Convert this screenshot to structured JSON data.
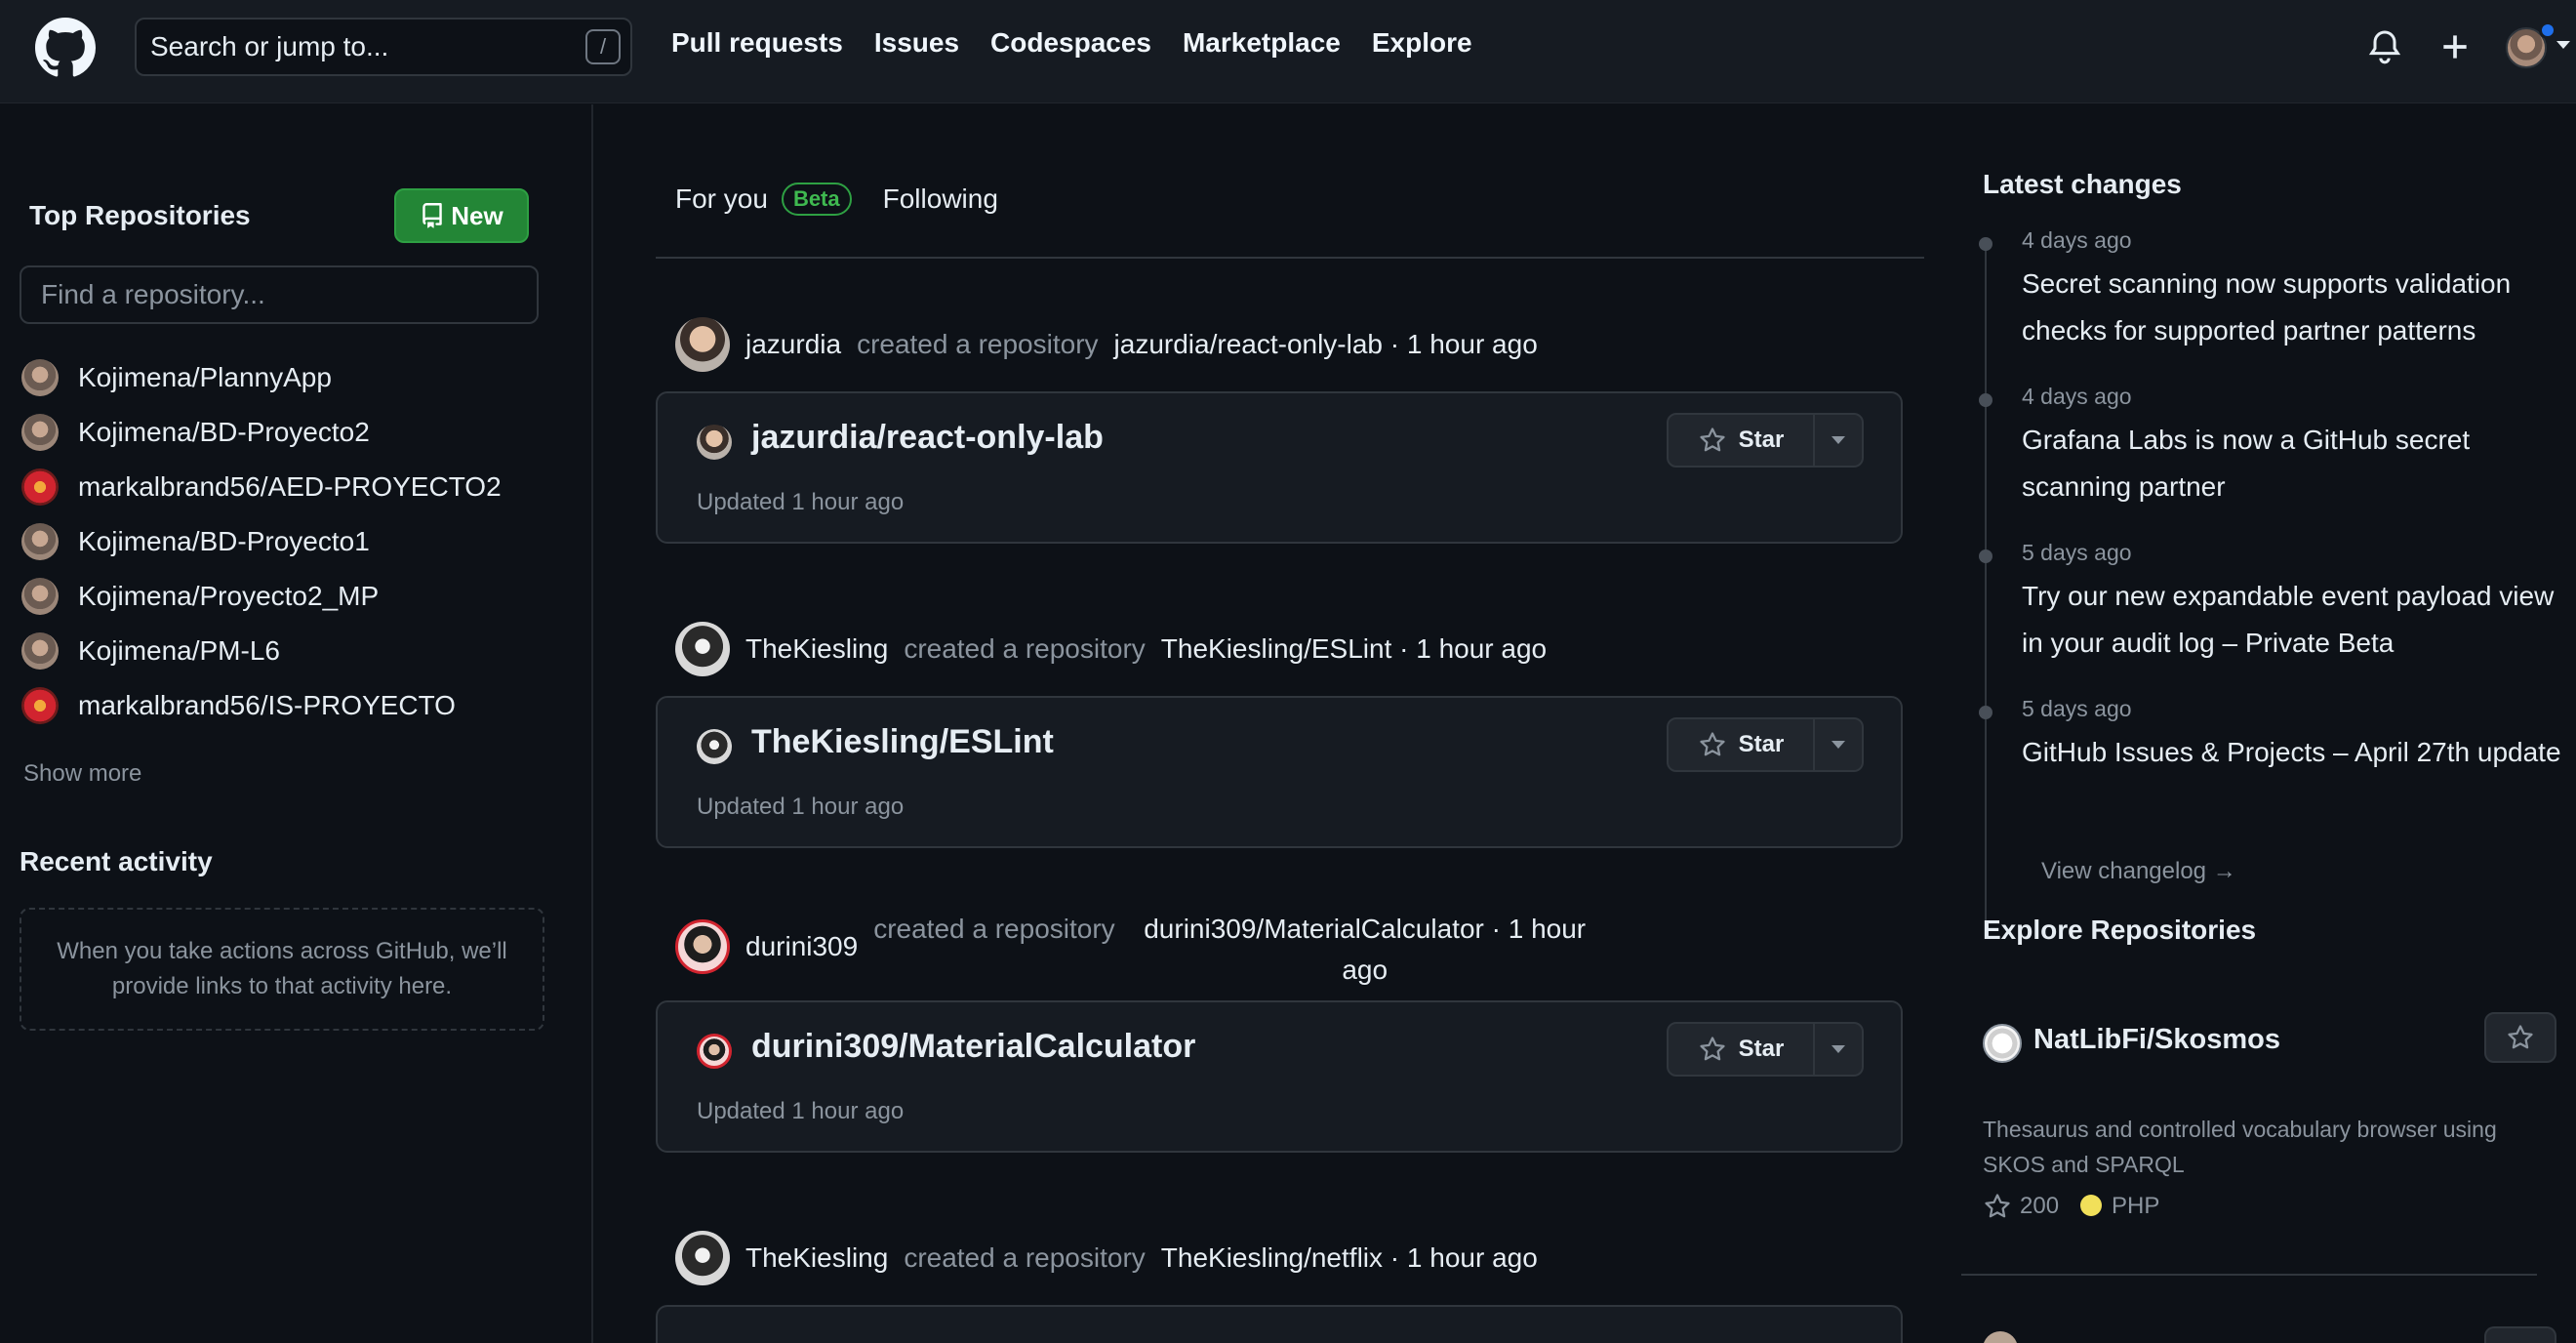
{
  "header": {
    "search_placeholder": "Search or jump to...",
    "search_shortcut": "/",
    "nav": [
      "Pull requests",
      "Issues",
      "Codespaces",
      "Marketplace",
      "Explore"
    ]
  },
  "sidebar": {
    "title": "Top Repositories",
    "new_button": "New",
    "find_placeholder": "Find a repository...",
    "repos": [
      {
        "name": "Kojimena/PlannyApp",
        "avatar": "gray"
      },
      {
        "name": "Kojimena/BD-Proyecto2",
        "avatar": "gray"
      },
      {
        "name": "markalbrand56/AED-PROYECTO2",
        "avatar": "red"
      },
      {
        "name": "Kojimena/BD-Proyecto1",
        "avatar": "gray"
      },
      {
        "name": "Kojimena/Proyecto2_MP",
        "avatar": "gray"
      },
      {
        "name": "Kojimena/PM-L6",
        "avatar": "gray"
      },
      {
        "name": "markalbrand56/IS-PROYECTO",
        "avatar": "red"
      }
    ],
    "show_more": "Show more",
    "recent_title": "Recent activity",
    "recent_empty": "When you take actions across GitHub, we’ll provide links to that activity here."
  },
  "feed": {
    "tabs": {
      "for_you": "For you",
      "beta": "Beta",
      "following": "Following"
    },
    "events": [
      {
        "user": "jazurdia",
        "action": "created a repository",
        "target": "jazurdia/react-only-lab · 1 hour ago",
        "repo": "jazurdia/react-only-lab",
        "updated": "Updated 1 hour ago",
        "star": "Star"
      },
      {
        "user": "TheKiesling",
        "action": "created a repository",
        "target": "TheKiesling/ESLint · 1 hour ago",
        "repo": "TheKiesling/ESLint",
        "updated": "Updated 1 hour ago",
        "star": "Star"
      },
      {
        "user": "durini309",
        "action": "created a repository",
        "target": "durini309/MaterialCalculator · 1 hour ago",
        "repo": "durini309/MaterialCalculator",
        "updated": "Updated 1 hour ago",
        "star": "Star"
      },
      {
        "user": "TheKiesling",
        "action": "created a repository",
        "target": "TheKiesling/netflix · 1 hour ago"
      }
    ]
  },
  "right": {
    "latest_title": "Latest changes",
    "changes": [
      {
        "date": "4 days ago",
        "text": "Secret scanning now supports validation checks for supported partner patterns"
      },
      {
        "date": "4 days ago",
        "text": "Grafana Labs is now a GitHub secret scanning partner"
      },
      {
        "date": "5 days ago",
        "text": "Try our new expandable event payload view in your audit log – Private Beta"
      },
      {
        "date": "5 days ago",
        "text": "GitHub Issues & Projects – April 27th update"
      }
    ],
    "view_changelog": "View changelog →",
    "explore_title": "Explore Repositories",
    "explore": {
      "name": "NatLibFi/Skosmos",
      "description": "Thesaurus and controlled vocabulary browser using SKOS and SPARQL",
      "stars": "200",
      "language": "PHP",
      "language_color": "#f1e05a"
    }
  },
  "colors": {
    "accent_green": "#238636",
    "background": "#0d1117",
    "header": "#161b22"
  }
}
